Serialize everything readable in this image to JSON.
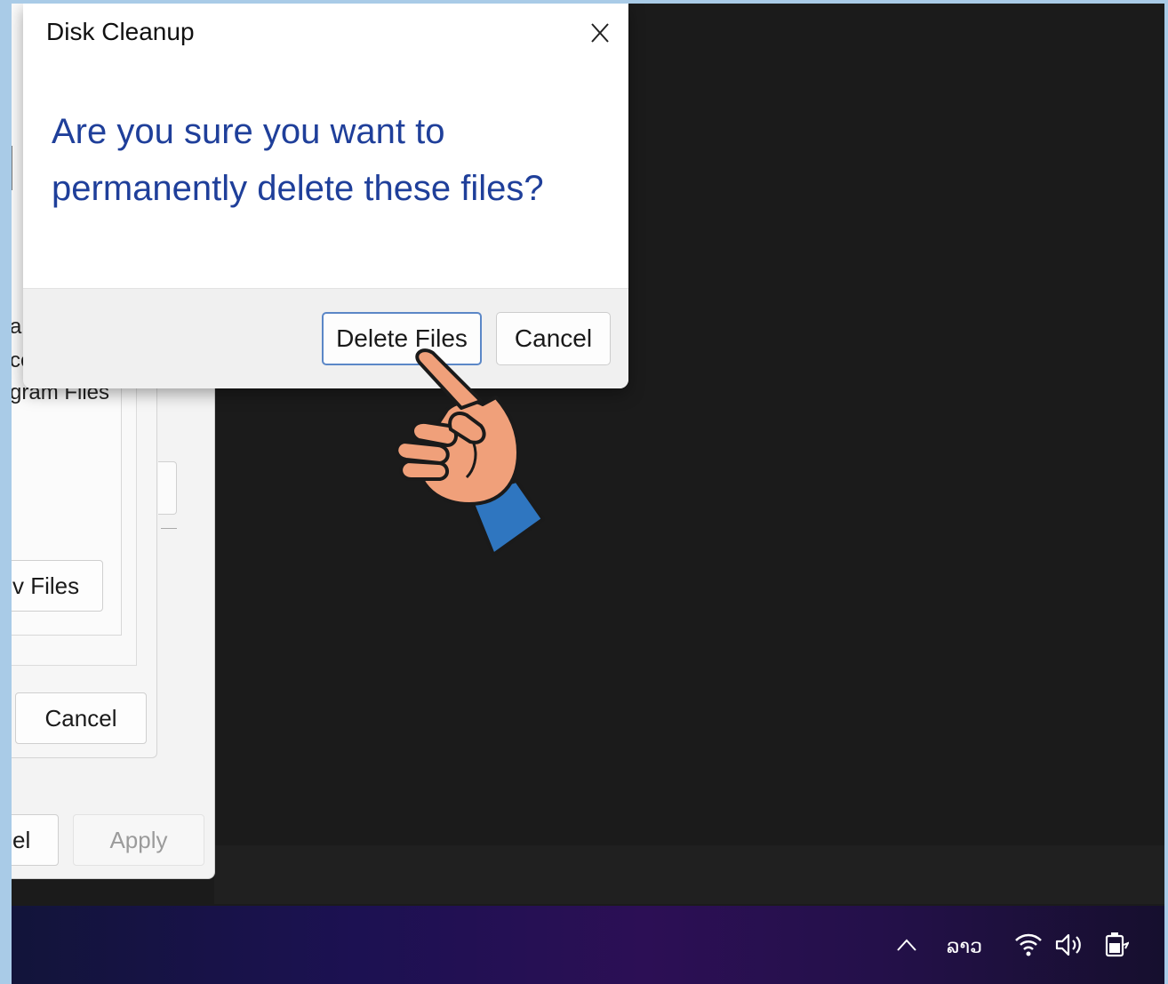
{
  "background_window": {
    "fragments": [
      "a",
      "ce",
      "gram Files"
    ],
    "view_files_label": "v Files",
    "cancel_label": "Cancel",
    "ok_fragment_label": "el",
    "apply_label": "Apply"
  },
  "dialog": {
    "title": "Disk Cleanup",
    "close_glyph": "X",
    "question": "Are you sure you want to permanently delete these files?",
    "delete_label": "Delete Files",
    "cancel_label": "Cancel"
  },
  "taskbar": {
    "chevron_glyph": "^",
    "language": "ລາວ"
  },
  "colors": {
    "question_text": "#1f3f9a",
    "primary_border": "#5b87c7",
    "desktop_bg": "#1b1b1b",
    "frame": "#a9cbe7"
  },
  "icons": [
    "close-icon",
    "pointing-hand-icon",
    "chevron-up-icon",
    "wifi-icon",
    "speaker-icon",
    "battery-icon"
  ]
}
